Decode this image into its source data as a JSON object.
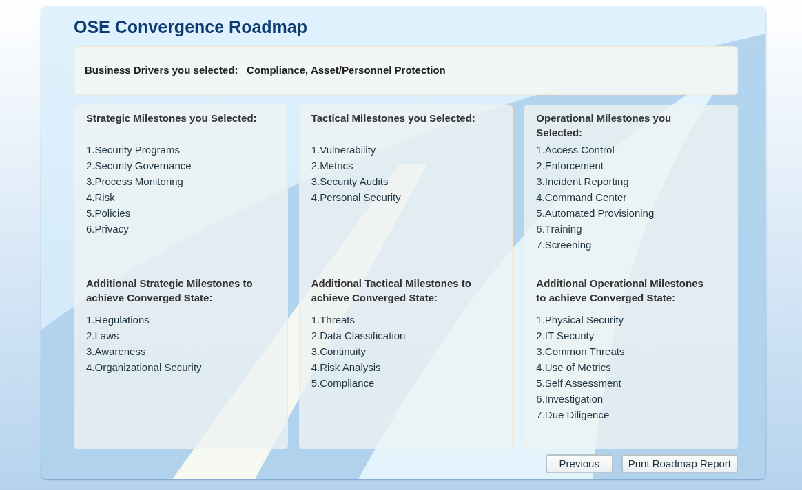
{
  "title": "OSE Convergence Roadmap",
  "business_drivers": {
    "label": "Business Drivers you selected:",
    "value": "Compliance, Asset/Personnel Protection"
  },
  "columns": [
    {
      "selected_heading": "Strategic  Milestones you Selected:",
      "selected": [
        "1.Security Programs",
        "2.Security Governance",
        "3.Process Monitoring",
        "4.Risk",
        "5.Policies",
        "6.Privacy"
      ],
      "additional_heading": "Additional Strategic Milestones to achieve Converged State:",
      "additional": [
        "1.Regulations",
        "2.Laws",
        "3.Awareness",
        "4.Organizational Security"
      ]
    },
    {
      "selected_heading": "Tactical Milestones you Selected:",
      "selected": [
        "1.Vulnerability",
        "2.Metrics",
        "3.Security Audits",
        "4.Personal Security"
      ],
      "additional_heading": "Additional Tactical Milestones to achieve Converged State:",
      "additional": [
        "1.Threats",
        "2.Data Classification",
        "3.Continuity",
        "4.Risk Analysis",
        "5.Compliance"
      ]
    },
    {
      "selected_heading": "Operational Milestones you Selected:",
      "selected": [
        "1.Access Control",
        "2.Enforcement",
        "3.Incident Reporting",
        "4.Command Center",
        "5.Automated Provisioning",
        "6.Training",
        "7.Screening"
      ],
      "additional_heading": "Additional Operational Milestones to achieve Converged State:",
      "additional": [
        "1.Physical Security",
        "2.IT Security",
        "3.Common Threats",
        "4.Use of Metrics",
        "5.Self Assessment",
        "6.Investigation",
        "7.Due Diligence"
      ]
    }
  ],
  "buttons": [
    "Previous",
    "Print Roadmap Report"
  ]
}
